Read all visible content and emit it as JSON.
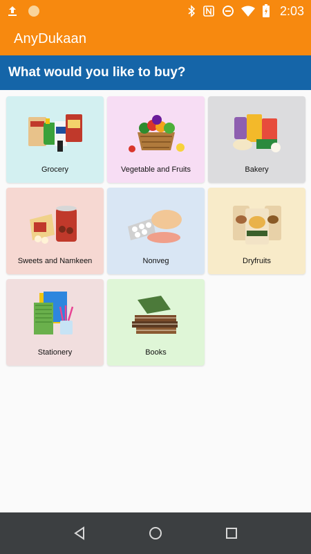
{
  "status_bar": {
    "time": "2:03",
    "icons": [
      "upload-icon",
      "circle-app-icon",
      "bluetooth-icon",
      "nfc-icon",
      "data-saver-icon",
      "wifi-icon",
      "battery-icon"
    ]
  },
  "app_bar": {
    "title": "AnyDukaan"
  },
  "prompt": {
    "text": "What would you like to buy?"
  },
  "categories": [
    {
      "label": "Grocery",
      "bg": "#d3f0f1"
    },
    {
      "label": "Vegetable and Fruits",
      "bg": "#f7ddf4"
    },
    {
      "label": "Bakery",
      "bg": "#dcdcde"
    },
    {
      "label": "Sweets and Namkeen",
      "bg": "#f6d8d2"
    },
    {
      "label": "Nonveg",
      "bg": "#d9e6f4"
    },
    {
      "label": "Dryfruits",
      "bg": "#f8ebc9"
    },
    {
      "label": "Stationery",
      "bg": "#f1dede"
    },
    {
      "label": "Books",
      "bg": "#dff6d7"
    }
  ],
  "colors": {
    "primary": "#f7890f",
    "prompt_bar": "#1565a8",
    "nav_bar": "#3c3f41"
  },
  "nav": {
    "icons": [
      "back-icon",
      "home-icon",
      "recents-icon"
    ]
  }
}
